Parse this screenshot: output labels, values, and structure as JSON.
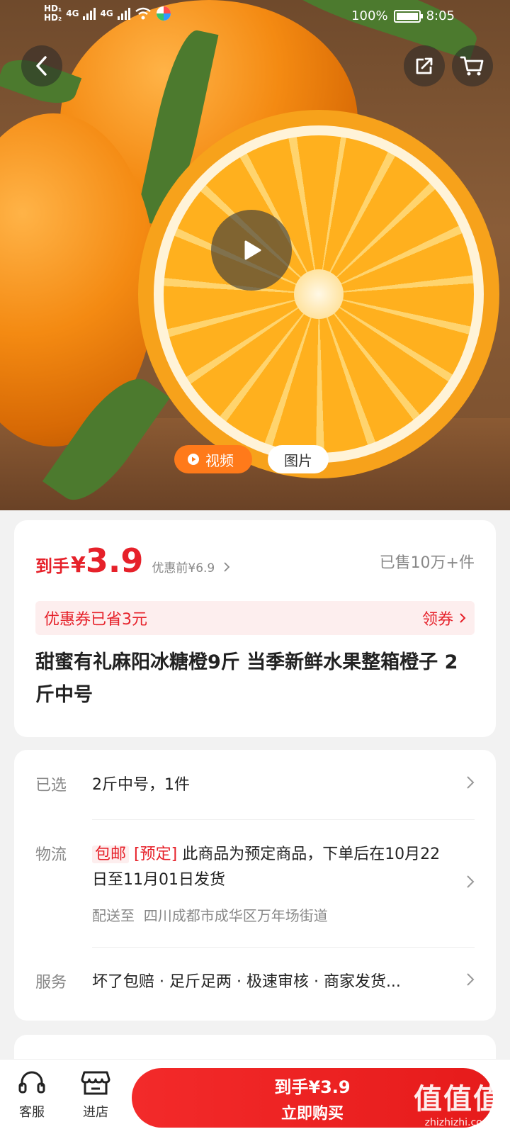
{
  "status_bar": {
    "hd1": "HD₁",
    "hd2": "HD₂",
    "network1": "4G",
    "network2": "4G",
    "battery": "100%",
    "battery_level": 1.0,
    "time": "8:05"
  },
  "media": {
    "tabs": [
      {
        "label": "视频",
        "active": true
      },
      {
        "label": "图片",
        "active": false
      }
    ]
  },
  "price": {
    "prefix": "到手",
    "currency": "¥",
    "value": "3.9",
    "before": "优惠前¥6.9"
  },
  "sold": "已售10万+件",
  "coupon": {
    "text": "优惠券已省3元",
    "claim": "领券"
  },
  "product_title": "甜蜜有礼麻阳冰糖橙9斤 当季新鲜水果整箱橙子 2斤中号",
  "selected": {
    "label": "已选",
    "value": "2斤中号，1件"
  },
  "logistics": {
    "label": "物流",
    "tag_free": "包邮",
    "tag_presale": "[预定]",
    "text": "此商品为预定商品，下单后在10月22日至11月01日发货",
    "ship_to_label": "配送至",
    "ship_to": "四川成都市成华区万年场街道"
  },
  "service": {
    "label": "服务",
    "value": "坏了包赔 · 足斤足两 · 极速审核 · 商家发货..."
  },
  "bottom_bar": {
    "service_label": "客服",
    "store_label": "进店",
    "buy_price": "到手¥3.9",
    "buy_label": "立即购买"
  },
  "watermark": {
    "big": "值值值",
    "small": "zhizhizhi.com"
  },
  "colors": {
    "accent": "#e6212a",
    "video_tab": "#ff7a1a"
  }
}
